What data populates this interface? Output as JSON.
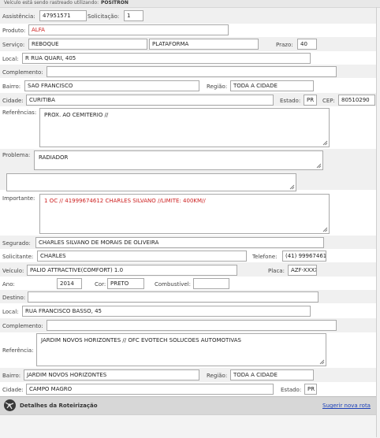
{
  "banner": {
    "prefix": "Veículo está sendo rastreado utilizando:",
    "tracker": "POSITRON"
  },
  "assistencia": {
    "label": "Assistência:",
    "value": "47951571"
  },
  "solicitacao": {
    "label": "Solicitação:",
    "value": "1"
  },
  "produto": {
    "label": "Produto:",
    "value": "ALFA"
  },
  "servico": {
    "label": "Serviço:",
    "value": "REBOQUE",
    "value2": "PLATAFORMA"
  },
  "prazo": {
    "label": "Prazo:",
    "value": "40"
  },
  "local": {
    "label": "Local:",
    "value": "R RUA QUARI, 405"
  },
  "complemento": {
    "label": "Complemento:",
    "value": ""
  },
  "bairro": {
    "label": "Bairro:",
    "value": "SAO FRANCISCO"
  },
  "regiao": {
    "label": "Região:",
    "value": "TODA A CIDADE"
  },
  "cidade": {
    "label": "Cidade:",
    "value": "CURITIBA"
  },
  "estado": {
    "label": "Estado:",
    "value": "PR"
  },
  "cep": {
    "label": "CEP:",
    "value": "80510290"
  },
  "referencias": {
    "label": "Referências:",
    "value": "PROX. AO CEMITERIO //"
  },
  "problema": {
    "label": "Problema:",
    "value": "RADIADOR",
    "extra": ""
  },
  "importante": {
    "label": "Importante:",
    "value": "1 OC // 41999674612  CHARLES SILVANO //LIMITE: 400KM//"
  },
  "segurado": {
    "label": "Segurado:",
    "value": "CHARLES SILVANO DE MORAIS DE OLIVEIRA"
  },
  "solicitante": {
    "label": "Solicitante:",
    "value": "CHARLES"
  },
  "telefone": {
    "label": "Telefone:",
    "value": "(41) 999674612"
  },
  "veiculo": {
    "label": "Veículo:",
    "value": "PALIO ATTRACTIVE(COMFORT) 1.0"
  },
  "placa": {
    "label": "Placa:",
    "value": "AZF-XXXX"
  },
  "ano": {
    "label": "Ano:",
    "value": "2014"
  },
  "cor": {
    "label": "Cor:",
    "value": "PRETO"
  },
  "combustivel": {
    "label": "Combustível:",
    "value": ""
  },
  "destino": {
    "label": "Destino:",
    "value": ""
  },
  "dest_local": {
    "label": "Local:",
    "value": "RUA FRANCISCO BASSO, 45"
  },
  "dest_complemento": {
    "label": "Complemento:",
    "value": ""
  },
  "dest_referencia": {
    "label": "Referência:",
    "value": "JARDIM NOVOS HORIZONTES   //  OFC EVOTECH SOLUCOES AUTOMOTIVAS"
  },
  "dest_bairro": {
    "label": "Bairro:",
    "value": "JARDIM NOVOS HORIZONTES"
  },
  "dest_regiao": {
    "label": "Região:",
    "value": "TODA A CIDADE"
  },
  "dest_cidade": {
    "label": "Cidade:",
    "value": "CAMPO MAGRO"
  },
  "dest_estado": {
    "label": "Estado:",
    "value": "PR"
  },
  "roteirizacao": {
    "title": "Detalhes da Roteirização",
    "link": "Sugerir nova rota"
  },
  "colors": {
    "required_red": "#cc1f1f",
    "link_blue": "#1a3fb8",
    "footer_gray": "#d7d7d7"
  }
}
